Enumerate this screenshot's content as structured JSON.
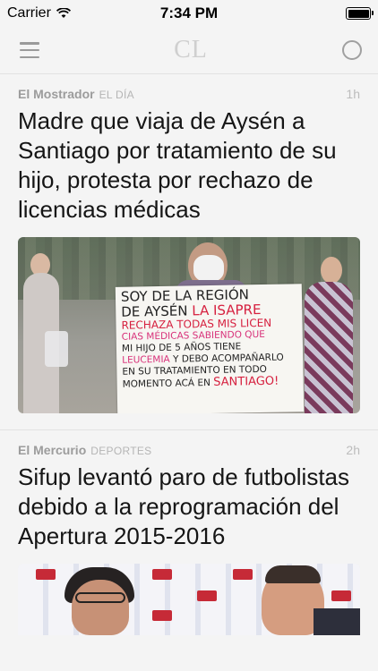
{
  "status_bar": {
    "carrier": "Carrier",
    "time": "7:34 PM",
    "wifi_icon": "wifi-icon",
    "battery_icon": "battery-icon",
    "battery_level": 1.0
  },
  "nav": {
    "logo": "CL",
    "menu_icon": "hamburger-menu-icon",
    "refresh_icon": "circle-refresh-icon"
  },
  "articles": [
    {
      "source": "El Mostrador",
      "section": "EL DÍA",
      "time": "1h",
      "headline": "Madre que viaja de Aysén a Santiago por tratamiento de su hijo, protesta por rechazo de licencias médicas",
      "image": {
        "sign_lines": [
          "SOY DE LA REGIÓN",
          "DE AYSÉN",
          "LA ISAPRE",
          "RECHAZA TODAS MIS LICEN",
          "CIAS MÉDICAS SABIENDO QUE",
          "MI HIJO DE 5 AÑOS TIENE",
          "LEUCEMIA",
          "Y DEBO ACOMPAÑARLO",
          "EN SU TRATAMIENTO EN TODO",
          "MOMENTO ACÁ EN",
          "SANTIAGO!"
        ]
      }
    },
    {
      "source": "El Mercurio",
      "section": "DEPORTES",
      "time": "2h",
      "headline": "Sifup levantó paro de futbolistas debido a la reprogramación del Apertura 2015-2016"
    }
  ],
  "colors": {
    "background": "#f4f4f4",
    "source_text": "#9c9c9c",
    "headline_text": "#151515",
    "sign_red": "#d6203f"
  }
}
